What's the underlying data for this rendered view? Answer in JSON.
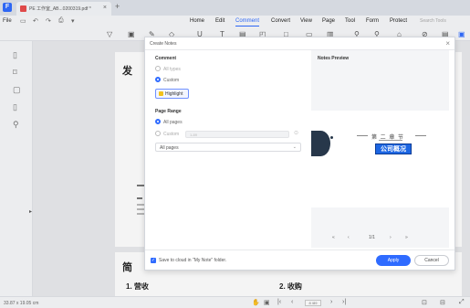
{
  "tab": {
    "name": "PE 工作室_AB...0200319.pdf *",
    "close": "×",
    "new": "+"
  },
  "menubar": {
    "file": "File",
    "items": [
      "Home",
      "Edit",
      "Comment",
      "Convert",
      "View",
      "Page",
      "Tool",
      "Form",
      "Protect"
    ],
    "active": "Comment",
    "search": "Search Tools"
  },
  "document": {
    "heading1": "发",
    "heading2": "简",
    "section1": "1. 营收",
    "section2": "2. 收购"
  },
  "dialog": {
    "title": "Create Notes",
    "comment_title": "Comment",
    "all_types": "All types",
    "custom": "Custom",
    "highlight": "Highlight",
    "page_range_title": "Page Range",
    "all_pages": "All pages",
    "custom_range": "Custom",
    "range_placeholder": "1-89",
    "pages_select": "All pages",
    "preview_title": "Notes Preview",
    "preview": {
      "chapter": "第 二 章 节",
      "overview": "公司概况"
    },
    "pager": {
      "count": "1/1"
    },
    "save_label": "Save to cloud in \"My Note\" folder.",
    "apply": "Apply",
    "cancel": "Cancel"
  },
  "status": {
    "dimensions": "33.87 x 19.05 cm",
    "page_box": "8 /89"
  },
  "colors": {
    "accent": "#2f6bff",
    "highlight_icon": "#f2c21b",
    "overview_fill": "#1c66e3"
  }
}
